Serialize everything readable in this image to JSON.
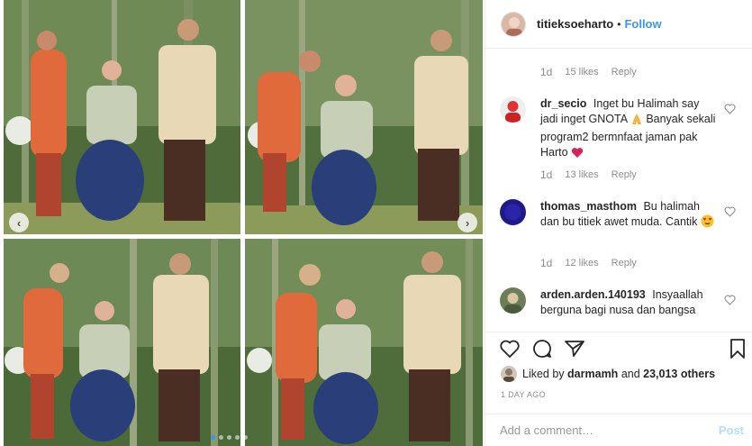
{
  "post": {
    "username": "titieksoeharto",
    "separator": "•",
    "follow_label": "Follow",
    "caption_meta": {
      "time": "1d",
      "likes": "15 likes",
      "reply": "Reply"
    }
  },
  "comments": [
    {
      "user": "dr_secio",
      "text": "Inget bu Halimah say jadi inget GNOTA",
      "text_after_emoji": "Banyak sekali program2 bermnfaat jaman pak Harto",
      "emojis": [
        "praying-hands",
        "heart"
      ],
      "time": "1d",
      "likes": "13 likes",
      "reply": "Reply"
    },
    {
      "user": "thomas_masthom",
      "text": "Bu halimah dan bu titiek awet muda. Cantik",
      "emojis": [
        "heart-eyes"
      ],
      "time": "1d",
      "likes": "12 likes",
      "reply": "Reply"
    },
    {
      "user": "arden.arden.140193",
      "text": "Insyaallah berguna bagi nusa dan bangsa",
      "emojis": []
    }
  ],
  "liked_by": {
    "prefix": "Liked by",
    "user": "darmamh",
    "middle": "and",
    "others": "23,013 others"
  },
  "timestamp": "1 DAY AGO",
  "add_comment": {
    "placeholder": "Add a comment…",
    "post_label": "Post"
  },
  "carousel": {
    "prev_icon": "‹",
    "next_icon": "›",
    "slide_count": 5,
    "active_index": 0
  },
  "colors": {
    "accent": "#3897f0",
    "post_disabled": "#b2dffc",
    "muted": "#8e8e8e",
    "heart": "#ed4956"
  }
}
